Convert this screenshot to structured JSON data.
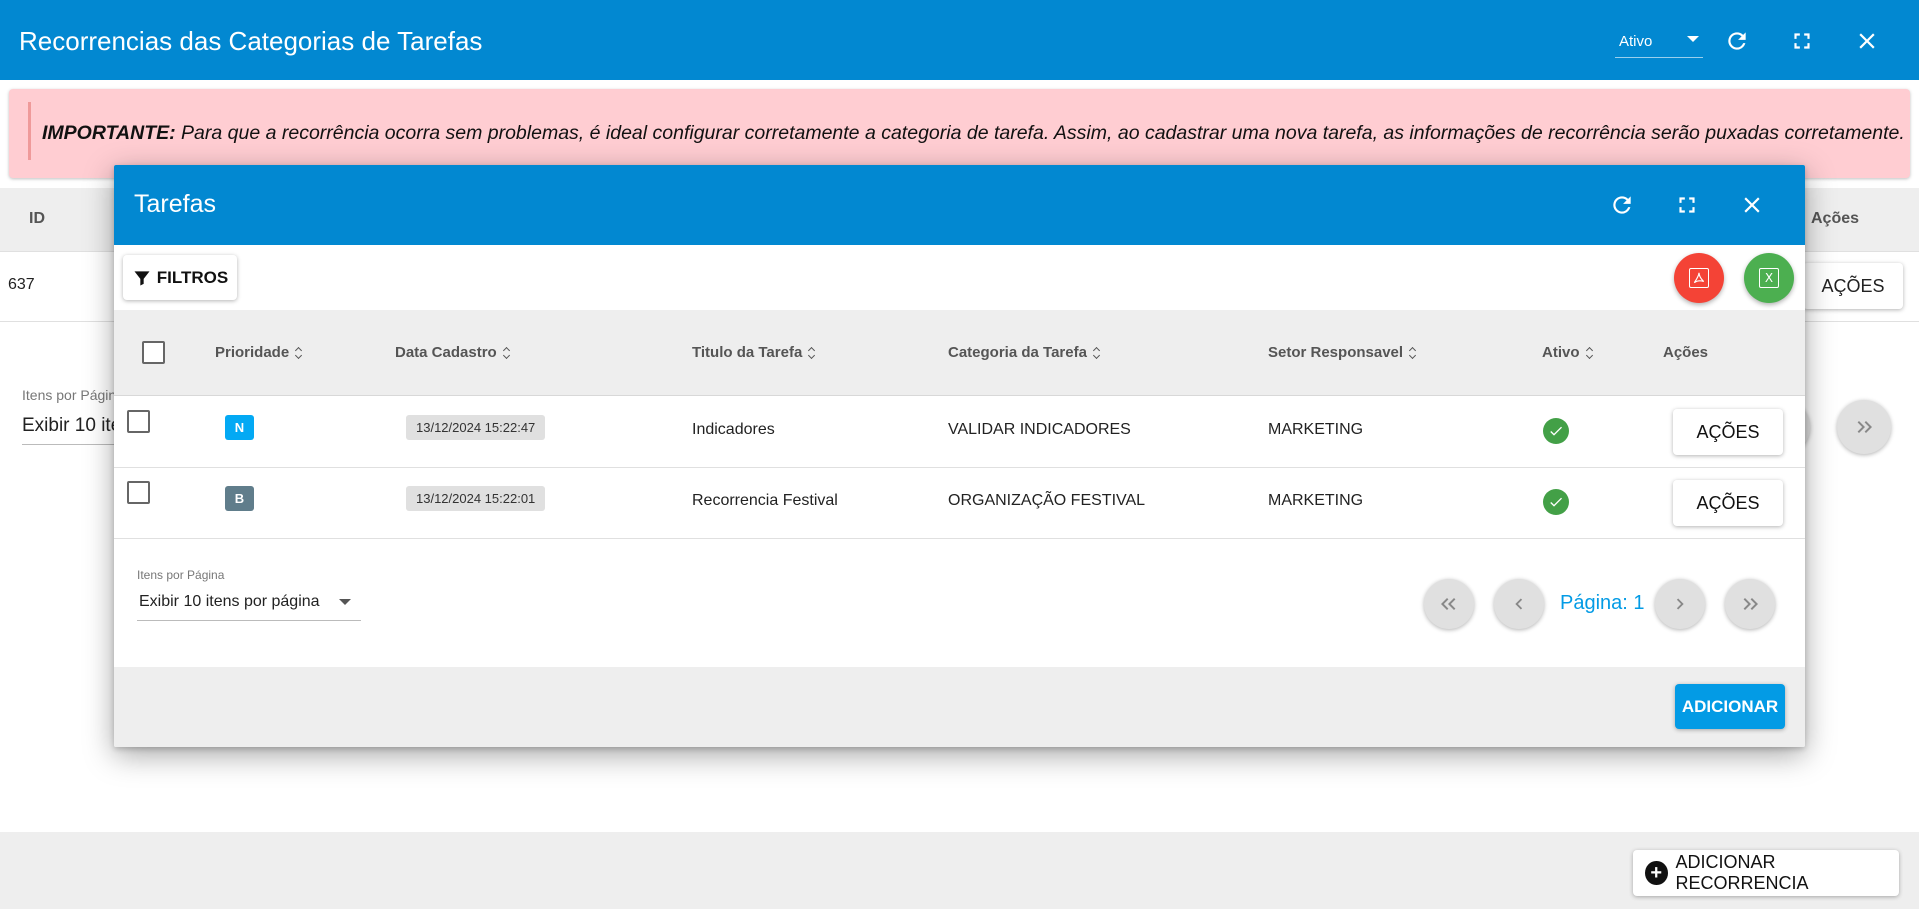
{
  "window": {
    "title": "Recorrencias das Categorias de Tarefas",
    "status_filter": "Ativo",
    "icons": [
      "refresh-icon",
      "fullscreen-icon",
      "close-icon"
    ]
  },
  "alert": {
    "strong": "IMPORTANTE:",
    "text": " Para que a recorrência ocorra sem problemas, é ideal configurar corretamente a categoria de tarefa. Assim, ao cadastrar uma nova tarefa, as informações de recorrência serão puxadas corretamente."
  },
  "bg_table": {
    "headers": {
      "id": "ID",
      "actions": "Ações"
    },
    "row": {
      "id": "637",
      "action_label": "AÇÕES"
    },
    "pagination": {
      "label": "Itens por Página",
      "select_value": "Exibir 10 itens por página"
    }
  },
  "bg_footer": {
    "add_button": "ADICIONAR RECORRENCIA"
  },
  "modal": {
    "title": "Tarefas",
    "filters_button": "FILTROS",
    "export": {
      "pdf_icon": "pdf-icon",
      "excel_icon": "excel-icon",
      "pdf_color": "#f44336",
      "excel_color": "#4caf50"
    },
    "headers": {
      "prioridade": "Prioridade",
      "data_cadastro": "Data Cadastro",
      "titulo": "Titulo da Tarefa",
      "categoria": "Categoria da Tarefa",
      "setor": "Setor Responsavel",
      "ativo": "Ativo",
      "acoes": "Ações"
    },
    "rows": [
      {
        "priority": "N",
        "priority_color": "#03a9f4",
        "date": "13/12/2024 15:22:47",
        "title": "Indicadores",
        "category": "VALIDAR INDICADORES",
        "sector": "MARKETING",
        "active": true,
        "action_label": "AÇÕES"
      },
      {
        "priority": "B",
        "priority_color": "#607d8b",
        "date": "13/12/2024 15:22:01",
        "title": "Recorrencia Festival",
        "category": "ORGANIZAÇÃO FESTIVAL",
        "sector": "MARKETING",
        "active": true,
        "action_label": "AÇÕES"
      }
    ],
    "pagination": {
      "label": "Itens por Página",
      "select_value": "Exibir 10 itens por página",
      "page_label": "Página: 1"
    },
    "add_button": "ADICIONAR"
  },
  "colors": {
    "primary": "#0288d1",
    "accent": "#039be5",
    "alert_bg": "#ffcdd2",
    "success": "#43a047"
  }
}
